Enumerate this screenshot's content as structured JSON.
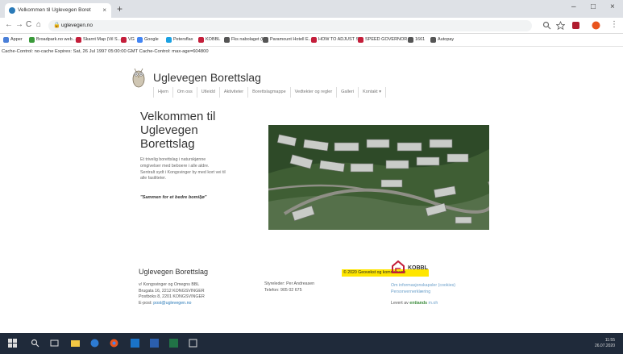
{
  "browser": {
    "tab_title": "Velkommen til Uglevegen Boret",
    "tab_close": "×",
    "new_tab": "+",
    "url": "uglevegen.no",
    "window_controls": [
      "–",
      "□",
      "×"
    ],
    "nav_buttons": [
      "←",
      "→",
      "C",
      "⌂"
    ]
  },
  "bookmarks": [
    {
      "label": "Apper",
      "color": "#4a7fd8"
    },
    {
      "label": "Broadpark.no web...",
      "color": "#3a9a3a"
    },
    {
      "label": "Skarnt Map (Vil S...",
      "color": "#c41e3a"
    },
    {
      "label": "VG",
      "color": "#c41e3a"
    },
    {
      "label": "Google",
      "color": "#4285f4"
    },
    {
      "label": "Petersflax",
      "color": "#1ba1e2"
    },
    {
      "label": "KOBBL",
      "color": "#c41e3a"
    },
    {
      "label": "Fks nabolaget (kr)",
      "color": "#555555"
    },
    {
      "label": "Paramount Hotell E...",
      "color": "#555555"
    },
    {
      "label": "HOW TO ADJUST S...",
      "color": "#c41e3a"
    },
    {
      "label": "SPEED GOVERNOR...",
      "color": "#c41e3a"
    },
    {
      "label": "1661",
      "color": "#555555"
    },
    {
      "label": "Autopay",
      "color": "#555555"
    }
  ],
  "page": {
    "cache_text": "Cache-Control: no-cache Expires: Sat, 26 Jul 1997 05:00:00 GMT Cache-Control: max-age=604800",
    "site_name": "Uglevegen Borettslag",
    "nav": [
      "Hjem",
      "Om oss",
      "Utleidd",
      "Aktiviteter",
      "Borettslagmappe",
      "Vedtekter og regler",
      "Galleri",
      "Kontakt ▾"
    ],
    "headline": [
      "Velkommen til",
      "Uglevegen",
      "Borettslag"
    ],
    "intro": [
      "Et trivelig borettslag i naturskjønne",
      "omgivelser med beboere i alle aldre.",
      "Sentralt sydt i Kongsvinger by med kort vei til",
      "alle fasiliteter."
    ],
    "motto": "\"Sammen for et bedre bomiljø\"",
    "photo_caption": "© 2020 Geovekst og kommunene"
  },
  "footer": {
    "title": "Uglevegen Borettslag",
    "address": [
      "v/ Kongsvinger og Omegns BBL",
      "Brugata 16, 2212 KONGSVINGER",
      "Postboks 8, 2201 KONGSVINGER"
    ],
    "email_label": "E-post:",
    "email": "post@uglevegen.no",
    "chair": "Styreleder: Per Andreasen",
    "phone": "Telefon: 905 02 675",
    "kobbl": "KOBBL",
    "links": [
      "Om informasjonskapsler (cookies)",
      "Personvernerklæring"
    ],
    "made_by_prefix": "Levert av",
    "made_by_brand": "entiands",
    "made_by_suffix": "m.oh"
  },
  "taskbar": {
    "time": "11:55",
    "date": "26.07.2020"
  }
}
